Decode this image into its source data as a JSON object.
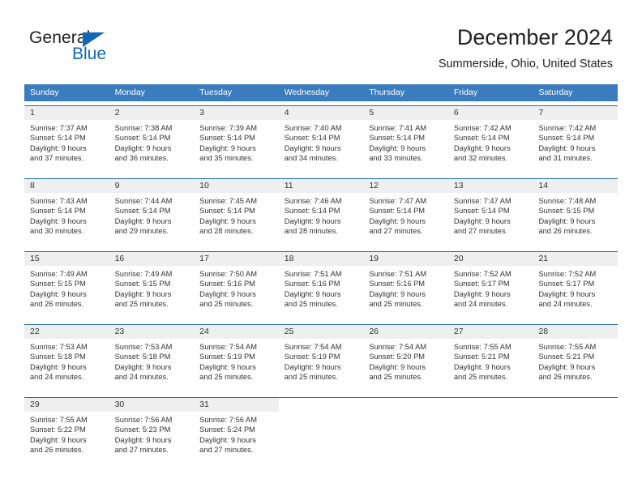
{
  "brand": {
    "name_part1": "General",
    "name_part2": "Blue",
    "accent_color": "#1268b3"
  },
  "header": {
    "title": "December 2024",
    "location": "Summerside, Ohio, United States"
  },
  "calendar": {
    "header_bg": "#3a7cbe",
    "daynum_bg": "#efefef",
    "rule_color": "#1f6cb0",
    "weekdays": [
      "Sunday",
      "Monday",
      "Tuesday",
      "Wednesday",
      "Thursday",
      "Friday",
      "Saturday"
    ],
    "weeks": [
      [
        {
          "day": "1",
          "sunrise": "Sunrise: 7:37 AM",
          "sunset": "Sunset: 5:14 PM",
          "daylight_line1": "Daylight: 9 hours",
          "daylight_line2": "and 37 minutes."
        },
        {
          "day": "2",
          "sunrise": "Sunrise: 7:38 AM",
          "sunset": "Sunset: 5:14 PM",
          "daylight_line1": "Daylight: 9 hours",
          "daylight_line2": "and 36 minutes."
        },
        {
          "day": "3",
          "sunrise": "Sunrise: 7:39 AM",
          "sunset": "Sunset: 5:14 PM",
          "daylight_line1": "Daylight: 9 hours",
          "daylight_line2": "and 35 minutes."
        },
        {
          "day": "4",
          "sunrise": "Sunrise: 7:40 AM",
          "sunset": "Sunset: 5:14 PM",
          "daylight_line1": "Daylight: 9 hours",
          "daylight_line2": "and 34 minutes."
        },
        {
          "day": "5",
          "sunrise": "Sunrise: 7:41 AM",
          "sunset": "Sunset: 5:14 PM",
          "daylight_line1": "Daylight: 9 hours",
          "daylight_line2": "and 33 minutes."
        },
        {
          "day": "6",
          "sunrise": "Sunrise: 7:42 AM",
          "sunset": "Sunset: 5:14 PM",
          "daylight_line1": "Daylight: 9 hours",
          "daylight_line2": "and 32 minutes."
        },
        {
          "day": "7",
          "sunrise": "Sunrise: 7:42 AM",
          "sunset": "Sunset: 5:14 PM",
          "daylight_line1": "Daylight: 9 hours",
          "daylight_line2": "and 31 minutes."
        }
      ],
      [
        {
          "day": "8",
          "sunrise": "Sunrise: 7:43 AM",
          "sunset": "Sunset: 5:14 PM",
          "daylight_line1": "Daylight: 9 hours",
          "daylight_line2": "and 30 minutes."
        },
        {
          "day": "9",
          "sunrise": "Sunrise: 7:44 AM",
          "sunset": "Sunset: 5:14 PM",
          "daylight_line1": "Daylight: 9 hours",
          "daylight_line2": "and 29 minutes."
        },
        {
          "day": "10",
          "sunrise": "Sunrise: 7:45 AM",
          "sunset": "Sunset: 5:14 PM",
          "daylight_line1": "Daylight: 9 hours",
          "daylight_line2": "and 28 minutes."
        },
        {
          "day": "11",
          "sunrise": "Sunrise: 7:46 AM",
          "sunset": "Sunset: 5:14 PM",
          "daylight_line1": "Daylight: 9 hours",
          "daylight_line2": "and 28 minutes."
        },
        {
          "day": "12",
          "sunrise": "Sunrise: 7:47 AM",
          "sunset": "Sunset: 5:14 PM",
          "daylight_line1": "Daylight: 9 hours",
          "daylight_line2": "and 27 minutes."
        },
        {
          "day": "13",
          "sunrise": "Sunrise: 7:47 AM",
          "sunset": "Sunset: 5:14 PM",
          "daylight_line1": "Daylight: 9 hours",
          "daylight_line2": "and 27 minutes."
        },
        {
          "day": "14",
          "sunrise": "Sunrise: 7:48 AM",
          "sunset": "Sunset: 5:15 PM",
          "daylight_line1": "Daylight: 9 hours",
          "daylight_line2": "and 26 minutes."
        }
      ],
      [
        {
          "day": "15",
          "sunrise": "Sunrise: 7:49 AM",
          "sunset": "Sunset: 5:15 PM",
          "daylight_line1": "Daylight: 9 hours",
          "daylight_line2": "and 26 minutes."
        },
        {
          "day": "16",
          "sunrise": "Sunrise: 7:49 AM",
          "sunset": "Sunset: 5:15 PM",
          "daylight_line1": "Daylight: 9 hours",
          "daylight_line2": "and 25 minutes."
        },
        {
          "day": "17",
          "sunrise": "Sunrise: 7:50 AM",
          "sunset": "Sunset: 5:16 PM",
          "daylight_line1": "Daylight: 9 hours",
          "daylight_line2": "and 25 minutes."
        },
        {
          "day": "18",
          "sunrise": "Sunrise: 7:51 AM",
          "sunset": "Sunset: 5:16 PM",
          "daylight_line1": "Daylight: 9 hours",
          "daylight_line2": "and 25 minutes."
        },
        {
          "day": "19",
          "sunrise": "Sunrise: 7:51 AM",
          "sunset": "Sunset: 5:16 PM",
          "daylight_line1": "Daylight: 9 hours",
          "daylight_line2": "and 25 minutes."
        },
        {
          "day": "20",
          "sunrise": "Sunrise: 7:52 AM",
          "sunset": "Sunset: 5:17 PM",
          "daylight_line1": "Daylight: 9 hours",
          "daylight_line2": "and 24 minutes."
        },
        {
          "day": "21",
          "sunrise": "Sunrise: 7:52 AM",
          "sunset": "Sunset: 5:17 PM",
          "daylight_line1": "Daylight: 9 hours",
          "daylight_line2": "and 24 minutes."
        }
      ],
      [
        {
          "day": "22",
          "sunrise": "Sunrise: 7:53 AM",
          "sunset": "Sunset: 5:18 PM",
          "daylight_line1": "Daylight: 9 hours",
          "daylight_line2": "and 24 minutes."
        },
        {
          "day": "23",
          "sunrise": "Sunrise: 7:53 AM",
          "sunset": "Sunset: 5:18 PM",
          "daylight_line1": "Daylight: 9 hours",
          "daylight_line2": "and 24 minutes."
        },
        {
          "day": "24",
          "sunrise": "Sunrise: 7:54 AM",
          "sunset": "Sunset: 5:19 PM",
          "daylight_line1": "Daylight: 9 hours",
          "daylight_line2": "and 25 minutes."
        },
        {
          "day": "25",
          "sunrise": "Sunrise: 7:54 AM",
          "sunset": "Sunset: 5:19 PM",
          "daylight_line1": "Daylight: 9 hours",
          "daylight_line2": "and 25 minutes."
        },
        {
          "day": "26",
          "sunrise": "Sunrise: 7:54 AM",
          "sunset": "Sunset: 5:20 PM",
          "daylight_line1": "Daylight: 9 hours",
          "daylight_line2": "and 25 minutes."
        },
        {
          "day": "27",
          "sunrise": "Sunrise: 7:55 AM",
          "sunset": "Sunset: 5:21 PM",
          "daylight_line1": "Daylight: 9 hours",
          "daylight_line2": "and 25 minutes."
        },
        {
          "day": "28",
          "sunrise": "Sunrise: 7:55 AM",
          "sunset": "Sunset: 5:21 PM",
          "daylight_line1": "Daylight: 9 hours",
          "daylight_line2": "and 26 minutes."
        }
      ],
      [
        {
          "day": "29",
          "sunrise": "Sunrise: 7:55 AM",
          "sunset": "Sunset: 5:22 PM",
          "daylight_line1": "Daylight: 9 hours",
          "daylight_line2": "and 26 minutes."
        },
        {
          "day": "30",
          "sunrise": "Sunrise: 7:56 AM",
          "sunset": "Sunset: 5:23 PM",
          "daylight_line1": "Daylight: 9 hours",
          "daylight_line2": "and 27 minutes."
        },
        {
          "day": "31",
          "sunrise": "Sunrise: 7:56 AM",
          "sunset": "Sunset: 5:24 PM",
          "daylight_line1": "Daylight: 9 hours",
          "daylight_line2": "and 27 minutes."
        },
        {
          "day": "",
          "sunrise": "",
          "sunset": "",
          "daylight_line1": "",
          "daylight_line2": ""
        },
        {
          "day": "",
          "sunrise": "",
          "sunset": "",
          "daylight_line1": "",
          "daylight_line2": ""
        },
        {
          "day": "",
          "sunrise": "",
          "sunset": "",
          "daylight_line1": "",
          "daylight_line2": ""
        },
        {
          "day": "",
          "sunrise": "",
          "sunset": "",
          "daylight_line1": "",
          "daylight_line2": ""
        }
      ]
    ]
  }
}
